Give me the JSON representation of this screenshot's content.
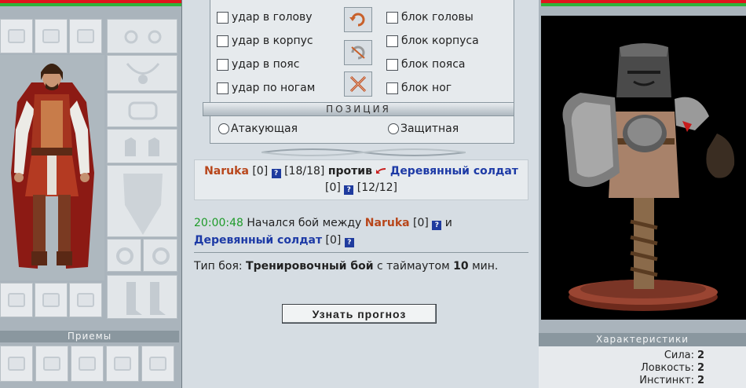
{
  "attack": {
    "options": [
      {
        "label": "удар в голову"
      },
      {
        "label": "удар в корпус"
      },
      {
        "label": "удар в пояс"
      },
      {
        "label": "удар по ногам"
      }
    ]
  },
  "defense": {
    "options": [
      {
        "label": "блок головы"
      },
      {
        "label": "блок корпуса"
      },
      {
        "label": "блок пояса"
      },
      {
        "label": "блок ног"
      }
    ]
  },
  "position": {
    "title": "ПОЗИЦИЯ",
    "options": [
      {
        "label": "Атакующая"
      },
      {
        "label": "Защитная"
      }
    ]
  },
  "battle": {
    "player_name": "Naruka",
    "player_level": "[0]",
    "player_hp": "[18/18]",
    "versus": "против",
    "enemy_name": "Деревянный солдат",
    "enemy_level": "[0]",
    "enemy_hp": "[12/12]",
    "info_icon": "?"
  },
  "log": {
    "time": "20:00:48",
    "text_prefix": "Начался бой между",
    "player_name": "Naruka",
    "player_level": "[0]",
    "conj": "и",
    "enemy_name": "Деревянный солдат",
    "enemy_level": "[0]"
  },
  "battle_type": {
    "prefix": "Тип боя:",
    "name": "Тренировочный бой",
    "middle": "с таймаутом",
    "timeout": "10",
    "unit": "мин."
  },
  "forecast_button": "Узнать прогноз",
  "left_panel": {
    "techniques_title": "Приемы"
  },
  "right_panel": {
    "stats_title": "Характеристики",
    "stats": [
      {
        "label": "Сила:",
        "value": "2"
      },
      {
        "label": "Ловкость:",
        "value": "2"
      },
      {
        "label": "Инстинкт:",
        "value": "2"
      }
    ]
  },
  "colors": {
    "hp_red": "#e0151b",
    "hp_green": "#2fb33a",
    "player_name": "#b8461b",
    "enemy_name": "#1d3aa6",
    "log_time": "#1f9b2a"
  }
}
